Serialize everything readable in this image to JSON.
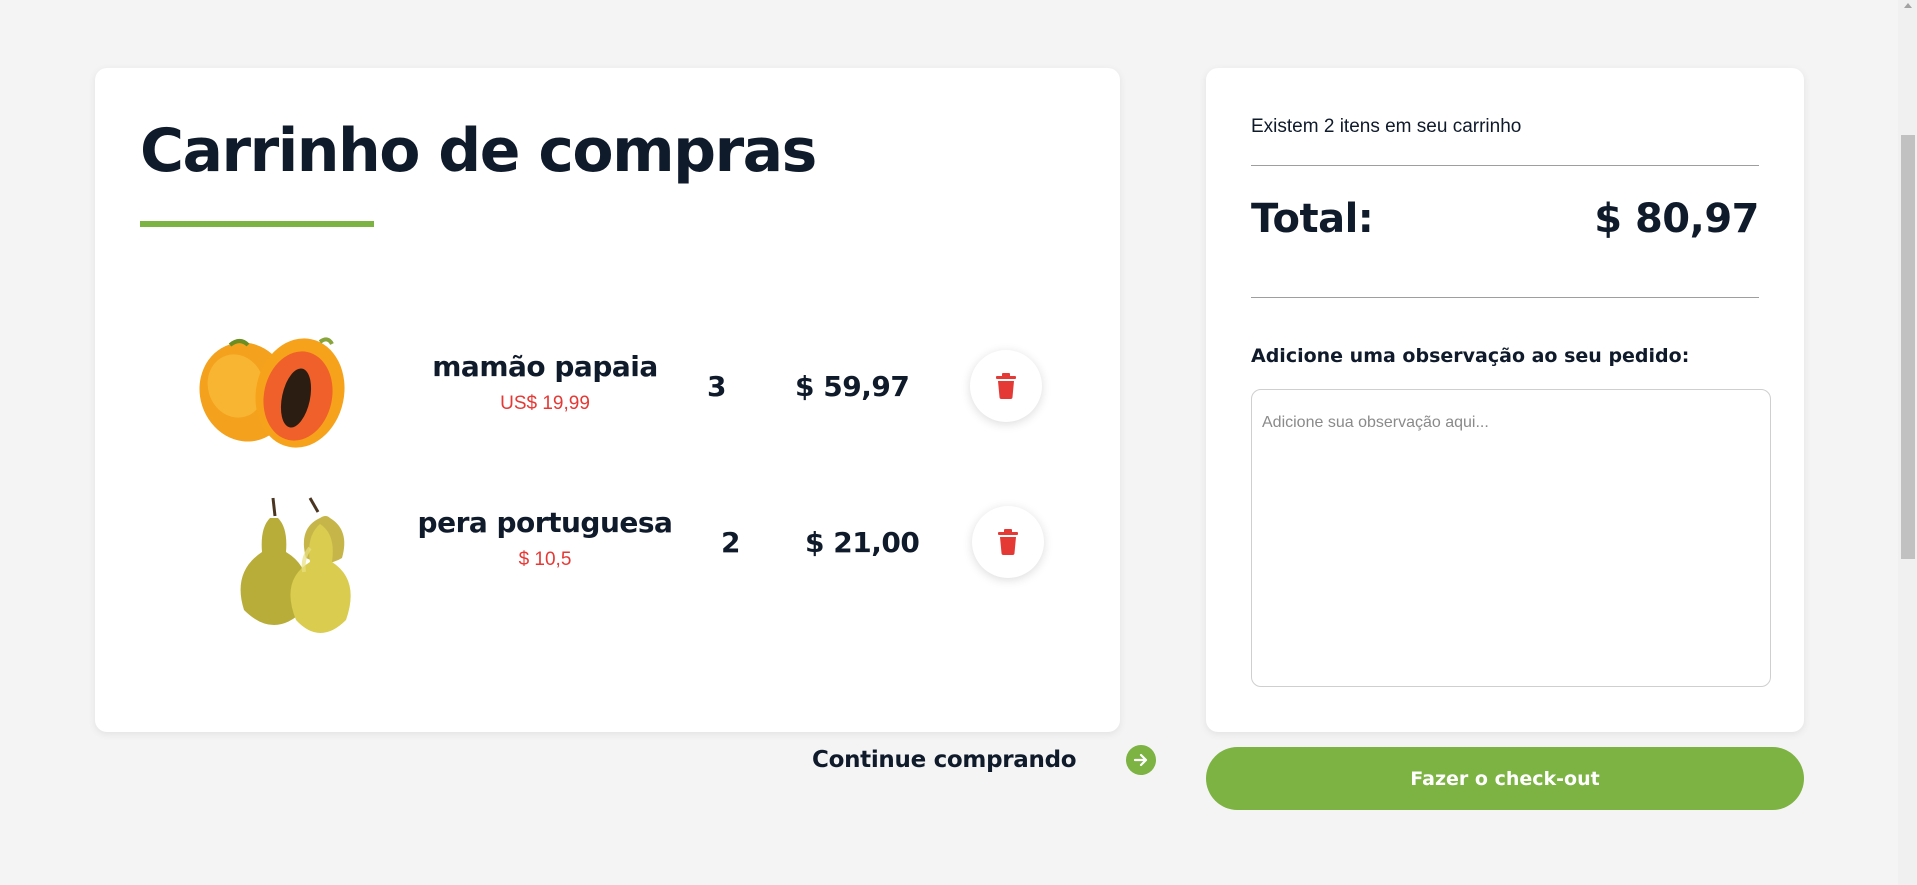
{
  "cart": {
    "title": "Carrinho de compras",
    "items": [
      {
        "name": "mamão papaia",
        "unit_price": "US$ 19,99",
        "quantity": "3",
        "total": "$ 59,97",
        "image": "papaya-image"
      },
      {
        "name": "pera portuguesa",
        "unit_price": "$ 10,5",
        "quantity": "2",
        "total": "$ 21,00",
        "image": "pear-image"
      }
    ],
    "continue_label": "Continue comprando"
  },
  "summary": {
    "item_count_text": "Existem 2 itens em seu carrinho",
    "total_label": "Total:",
    "total_value": "$ 80,97",
    "note_label": "Adicione uma observação ao seu pedido:",
    "note_value": "",
    "note_placeholder": "Adicione sua observação aqui...",
    "checkout_label": "Fazer o check-out"
  },
  "colors": {
    "accent_green": "#7cb342",
    "price_red": "#e53935",
    "text_dark": "#0f1a2b",
    "background": "#f4f4f4"
  },
  "icons": {
    "delete": "trash-icon",
    "continue": "arrow-right-icon"
  }
}
